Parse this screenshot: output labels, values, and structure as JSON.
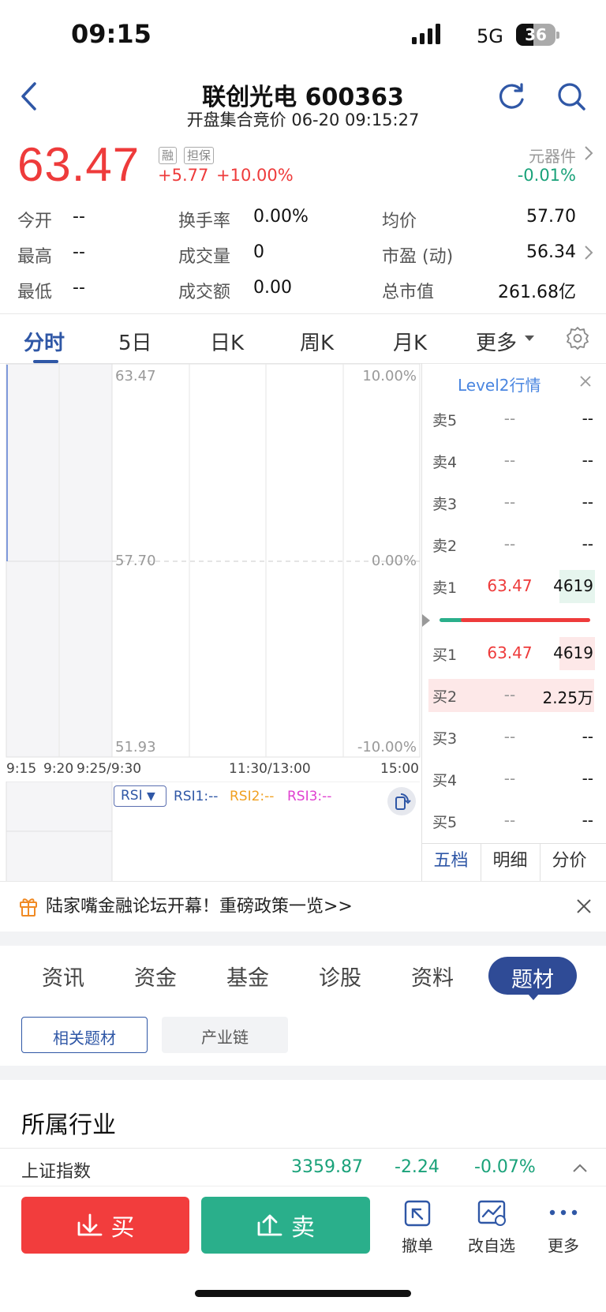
{
  "status_bar": {
    "time": "09:15",
    "network": "5G",
    "battery": "36"
  },
  "header": {
    "title": "联创光电 600363",
    "subtitle": "开盘集合竞价 06-20 09:15:27"
  },
  "quote": {
    "price": "63.47",
    "tag_margin": "融",
    "tag_guarantee": "担保",
    "change": "+5.77",
    "change_pct": "+10.00%",
    "sector_name": "元器件",
    "sector_change": "-0.01%"
  },
  "stats": {
    "open_label": "今开",
    "open_value": "--",
    "high_label": "最高",
    "high_value": "--",
    "low_label": "最低",
    "low_value": "--",
    "turnover_rate_label": "换手率",
    "turnover_rate_value": "0.00%",
    "volume_label": "成交量",
    "volume_value": "0",
    "amount_label": "成交额",
    "amount_value": "0.00",
    "avg_label": "均价",
    "avg_value": "57.70",
    "pe_label": "市盈 (动)",
    "pe_value": "56.34",
    "mktcap_label": "总市值",
    "mktcap_value": "261.68亿"
  },
  "chart_tabs": {
    "intraday": "分时",
    "five_day": "5日",
    "day_k": "日K",
    "week_k": "周K",
    "month_k": "月K",
    "more": "更多"
  },
  "chart": {
    "price_top": "63.47",
    "price_mid": "57.70",
    "price_bottom": "51.93",
    "pct_top": "10.00%",
    "pct_mid": "0.00%",
    "pct_bottom": "-10.00%",
    "time_0915": "9:15",
    "time_0920": "9:20",
    "time_0925_0930": "9:25/9:30",
    "time_1130_1300": "11:30/13:00",
    "time_1500": "15:00"
  },
  "indicator": {
    "name": "RSI",
    "rsi1": "RSI1:--",
    "rsi2": "RSI2:--",
    "rsi3": "RSI3:--"
  },
  "colors": {
    "red": "#ee3b3b",
    "green": "#1aa27a",
    "blue": "#2f57a6",
    "rsi2": "#f0a020",
    "rsi3": "#e040d0"
  },
  "order_book": {
    "title": "Level2行情",
    "sells": [
      {
        "label": "卖5",
        "price": "--",
        "volume": "--"
      },
      {
        "label": "卖4",
        "price": "--",
        "volume": "--"
      },
      {
        "label": "卖3",
        "price": "--",
        "volume": "--"
      },
      {
        "label": "卖2",
        "price": "--",
        "volume": "--"
      },
      {
        "label": "卖1",
        "price": "63.47",
        "volume": "4619"
      }
    ],
    "buys": [
      {
        "label": "买1",
        "price": "63.47",
        "volume": "4619"
      },
      {
        "label": "买2",
        "price": "--",
        "volume": "2.25万"
      },
      {
        "label": "买3",
        "price": "--",
        "volume": "--"
      },
      {
        "label": "买4",
        "price": "--",
        "volume": "--"
      },
      {
        "label": "买5",
        "price": "--",
        "volume": "--"
      }
    ],
    "tabs": {
      "five_level": "五档",
      "detail": "明细",
      "price_dist": "分价"
    }
  },
  "notice": {
    "text": "陆家嘴金融论坛开幕！重磅政策一览>>"
  },
  "info_tabs": {
    "news": "资讯",
    "funds": "资金",
    "fundamentals": "基金",
    "diagnose": "诊股",
    "profile": "资料",
    "themes": "题材"
  },
  "sub_tabs": {
    "related": "相关题材",
    "chain": "产业链"
  },
  "section": {
    "title": "所属行业",
    "index_name": "上证指数",
    "index_value": "3359.87",
    "index_change": "-2.24",
    "index_pct": "-0.07%"
  },
  "bottom_bar": {
    "buy": "买",
    "sell": "卖",
    "cancel": "撤单",
    "edit_watch": "改自选",
    "more": "更多"
  }
}
